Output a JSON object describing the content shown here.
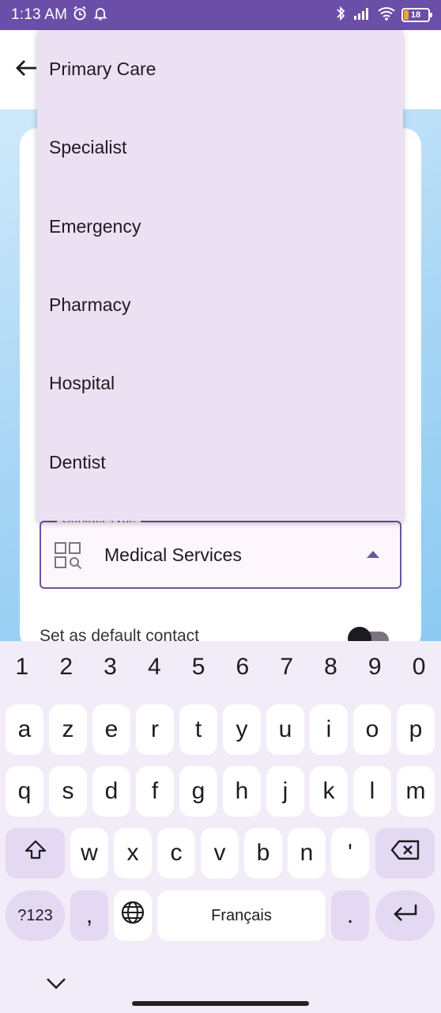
{
  "status_bar": {
    "time": "1:13 AM",
    "battery": "18",
    "icons": [
      "alarm-icon",
      "notification-icon",
      "bluetooth-icon",
      "signal-icon",
      "wifi-icon",
      "battery-icon"
    ]
  },
  "header": {
    "back_icon": "arrow-left-icon"
  },
  "dropdown": {
    "items": [
      {
        "label": "Primary Care"
      },
      {
        "label": "Specialist"
      },
      {
        "label": "Emergency"
      },
      {
        "label": "Pharmacy"
      },
      {
        "label": "Hospital"
      },
      {
        "label": "Dentist"
      }
    ]
  },
  "form": {
    "contact_type": {
      "label": "Contact Type",
      "value": "Medical Services",
      "icon": "category-search-icon"
    },
    "default_contact": {
      "label": "Set as default contact",
      "enabled": false
    }
  },
  "keyboard": {
    "numbers": [
      "1",
      "2",
      "3",
      "4",
      "5",
      "6",
      "7",
      "8",
      "9",
      "0"
    ],
    "row1": [
      "a",
      "z",
      "e",
      "r",
      "t",
      "y",
      "u",
      "i",
      "o",
      "p"
    ],
    "row2": [
      "q",
      "s",
      "d",
      "f",
      "g",
      "h",
      "j",
      "k",
      "l",
      "m"
    ],
    "row3": [
      "w",
      "x",
      "c",
      "v",
      "b",
      "n",
      "'"
    ],
    "symbols_key": "?123",
    "comma_key": ",",
    "space_label": "Français",
    "period_key": ".",
    "colors": {
      "background": "#f2ebf8",
      "key": "#ffffff",
      "special_key": "#e3d9f2"
    }
  },
  "colors": {
    "status_bar": "#6a4ea8",
    "accent": "#6b55a3",
    "dropdown_bg": "#ebe1f2"
  }
}
